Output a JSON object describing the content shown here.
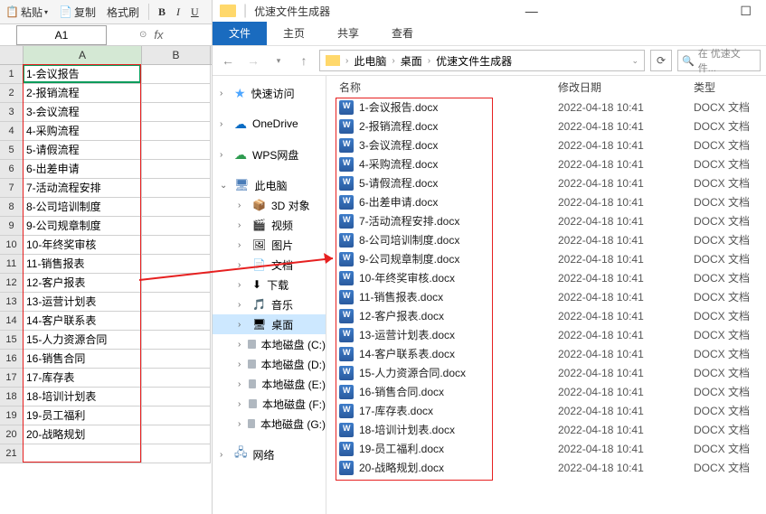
{
  "excel": {
    "toolbar": {
      "paste": "粘贴",
      "copy": "复制",
      "format_painter": "格式刷",
      "B": "B",
      "I": "I",
      "U": "U"
    },
    "name_box": "A1",
    "fx": "fx",
    "col_a": "A",
    "col_b": "B",
    "rows": [
      "1",
      "2",
      "3",
      "4",
      "5",
      "6",
      "7",
      "8",
      "9",
      "10",
      "11",
      "12",
      "13",
      "14",
      "15",
      "16",
      "17",
      "18",
      "19",
      "20",
      "21"
    ],
    "cells": [
      "1-会议报告",
      "2-报销流程",
      "3-会议流程",
      "4-采购流程",
      "5-请假流程",
      "6-出差申请",
      "7-活动流程安排",
      "8-公司培训制度",
      "9-公司规章制度",
      "10-年终奖审核",
      "11-销售报表",
      "12-客户报表",
      "13-运营计划表",
      "14-客户联系表",
      "15-人力资源合同",
      "16-销售合同",
      "17-库存表",
      "18-培训计划表",
      "19-员工福利",
      "20-战略规划"
    ]
  },
  "explorer": {
    "title": "优速文件生成器",
    "tabs": {
      "file": "文件",
      "home": "主页",
      "share": "共享",
      "view": "查看"
    },
    "breadcrumb": [
      "此电脑",
      "桌面",
      "优速文件生成器"
    ],
    "search_placeholder": "在 优速文件...",
    "nav": {
      "quick_access": "快速访问",
      "onedrive": "OneDrive",
      "wps": "WPS网盘",
      "this_pc": "此电脑",
      "items": [
        "3D 对象",
        "视频",
        "图片",
        "文档",
        "下载",
        "音乐",
        "桌面",
        "本地磁盘 (C:)",
        "本地磁盘 (D:)",
        "本地磁盘 (E:)",
        "本地磁盘 (F:)",
        "本地磁盘 (G:)"
      ],
      "network": "网络"
    },
    "headers": {
      "name": "名称",
      "date": "修改日期",
      "type": "类型"
    },
    "files": [
      {
        "name": "1-会议报告.docx",
        "date": "2022-04-18 10:41",
        "type": "DOCX 文档"
      },
      {
        "name": "2-报销流程.docx",
        "date": "2022-04-18 10:41",
        "type": "DOCX 文档"
      },
      {
        "name": "3-会议流程.docx",
        "date": "2022-04-18 10:41",
        "type": "DOCX 文档"
      },
      {
        "name": "4-采购流程.docx",
        "date": "2022-04-18 10:41",
        "type": "DOCX 文档"
      },
      {
        "name": "5-请假流程.docx",
        "date": "2022-04-18 10:41",
        "type": "DOCX 文档"
      },
      {
        "name": "6-出差申请.docx",
        "date": "2022-04-18 10:41",
        "type": "DOCX 文档"
      },
      {
        "name": "7-活动流程安排.docx",
        "date": "2022-04-18 10:41",
        "type": "DOCX 文档"
      },
      {
        "name": "8-公司培训制度.docx",
        "date": "2022-04-18 10:41",
        "type": "DOCX 文档"
      },
      {
        "name": "9-公司规章制度.docx",
        "date": "2022-04-18 10:41",
        "type": "DOCX 文档"
      },
      {
        "name": "10-年终奖审核.docx",
        "date": "2022-04-18 10:41",
        "type": "DOCX 文档"
      },
      {
        "name": "11-销售报表.docx",
        "date": "2022-04-18 10:41",
        "type": "DOCX 文档"
      },
      {
        "name": "12-客户报表.docx",
        "date": "2022-04-18 10:41",
        "type": "DOCX 文档"
      },
      {
        "name": "13-运营计划表.docx",
        "date": "2022-04-18 10:41",
        "type": "DOCX 文档"
      },
      {
        "name": "14-客户联系表.docx",
        "date": "2022-04-18 10:41",
        "type": "DOCX 文档"
      },
      {
        "name": "15-人力资源合同.docx",
        "date": "2022-04-18 10:41",
        "type": "DOCX 文档"
      },
      {
        "name": "16-销售合同.docx",
        "date": "2022-04-18 10:41",
        "type": "DOCX 文档"
      },
      {
        "name": "17-库存表.docx",
        "date": "2022-04-18 10:41",
        "type": "DOCX 文档"
      },
      {
        "name": "18-培训计划表.docx",
        "date": "2022-04-18 10:41",
        "type": "DOCX 文档"
      },
      {
        "name": "19-员工福利.docx",
        "date": "2022-04-18 10:41",
        "type": "DOCX 文档"
      },
      {
        "name": "20-战略规划.docx",
        "date": "2022-04-18 10:41",
        "type": "DOCX 文档"
      }
    ]
  }
}
